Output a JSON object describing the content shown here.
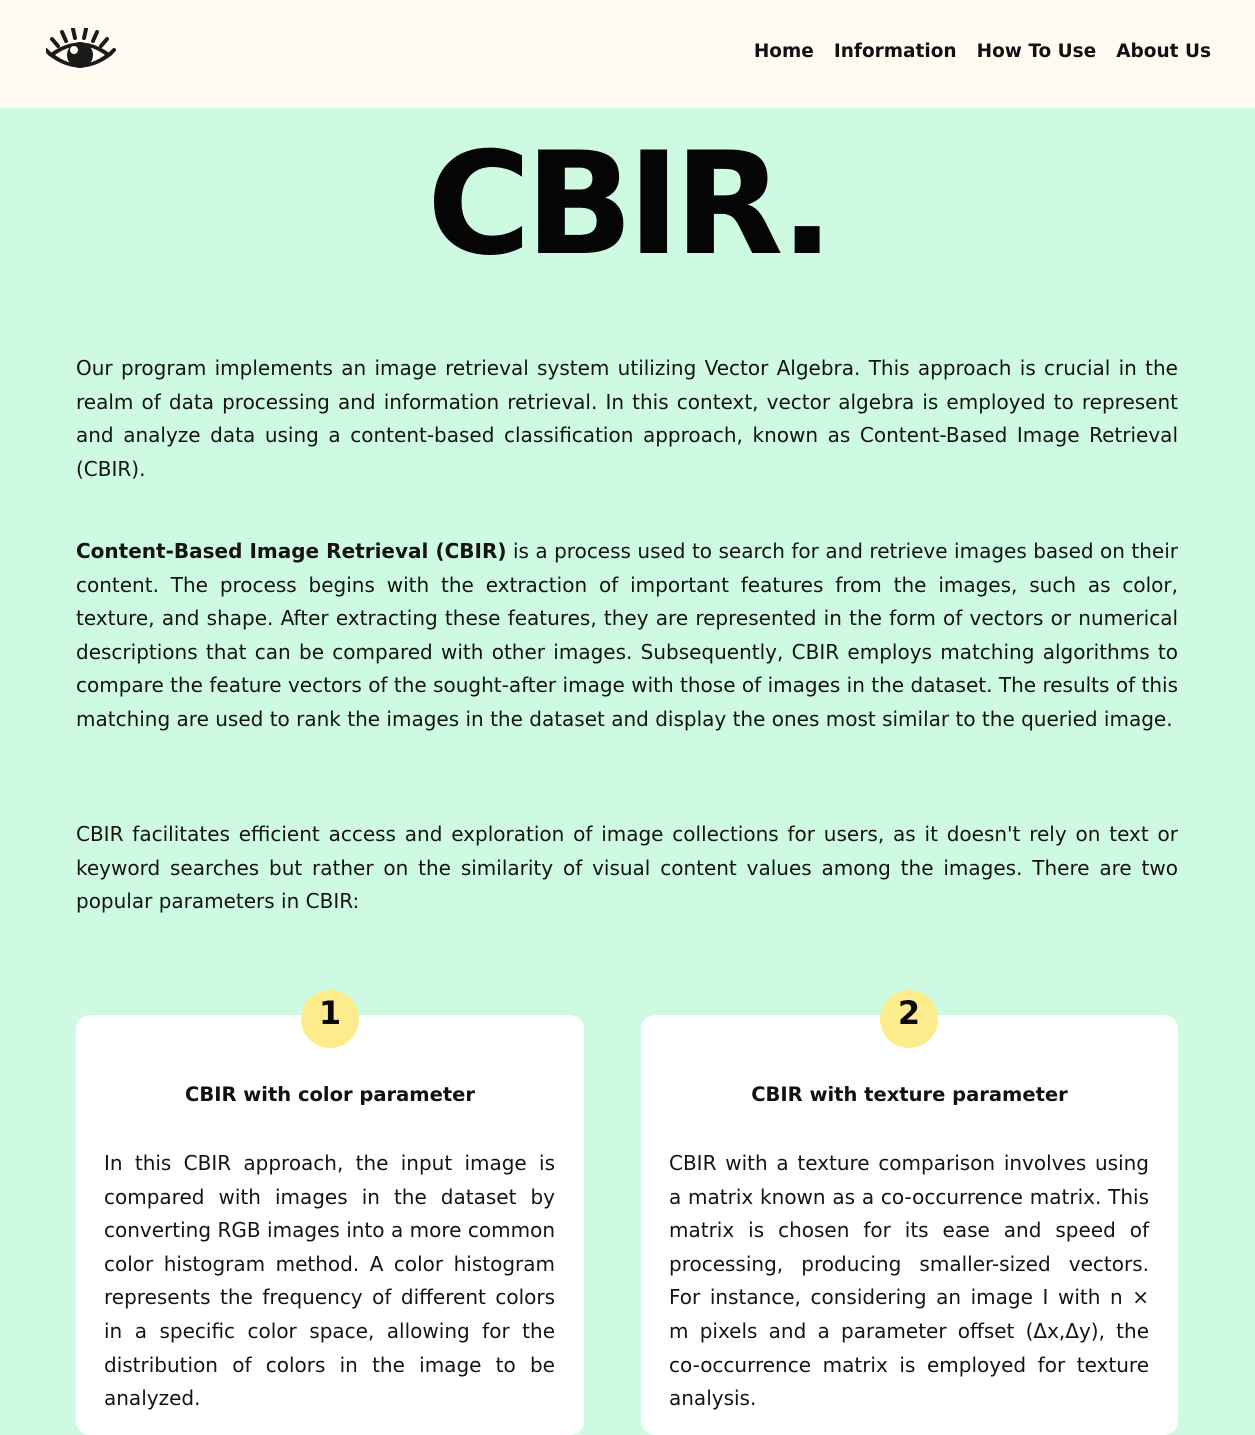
{
  "nav": {
    "logo_icon": "eye-icon",
    "links": [
      "Home",
      "Information",
      "How To Use",
      "About Us"
    ]
  },
  "hero": {
    "title": "CBIR."
  },
  "intro": {
    "p1": "Our program implements an image retrieval system utilizing Vector Algebra. This approach is crucial in the realm of data processing and information retrieval. In this context, vector algebra is employed to represent and analyze data using a content-based classification approach, known as Content-Based Image Retrieval (CBIR).",
    "p2_bold": "Content-Based Image Retrieval (CBIR)",
    "p2_rest": " is a process used to search for and retrieve images based on their content. The process begins with the extraction of important features from the images, such as color, texture, and shape. After extracting these features, they are represented in the form of vectors or numerical descriptions that can be compared with other images. Subsequently, CBIR employs matching algorithms to compare the feature vectors of the sought-after image with those of images in the dataset. The results of this matching are used to rank the images in the dataset and display the ones most similar to the queried image.",
    "p3": "CBIR facilitates efficient access and exploration of image collections for users, as it doesn't rely on text or keyword searches but rather on the similarity of visual content values among the images. There are two popular parameters in CBIR:"
  },
  "cards": [
    {
      "number": "1",
      "title": "CBIR with color parameter",
      "body": "In this CBIR approach, the input image is compared with images in the dataset by converting RGB images into a more common color histogram method. A color histogram represents the frequency of different colors in a specific color space, allowing for the distribution of colors in the image to be analyzed."
    },
    {
      "number": "2",
      "title": "CBIR with texture parameter",
      "body": "CBIR with a texture comparison involves using a matrix known as a co-occurrence matrix. This matrix is chosen for its ease and speed of processing, producing smaller-sized vectors. For instance, considering an image I with n × m pixels and a parameter offset (Δx,Δy), the co-occurrence matrix is employed for texture analysis."
    }
  ],
  "colors": {
    "background": "#cffae2",
    "navbar": "#fffbf1",
    "card": "#ffffff",
    "badge": "#fdec8c",
    "text": "#111111"
  }
}
